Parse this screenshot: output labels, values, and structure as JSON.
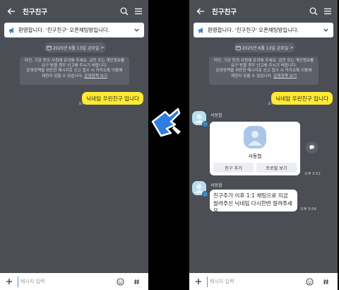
{
  "header": {
    "title": "친구친구"
  },
  "notice": {
    "text": "환영합니다. '친구친구' 오픈채팅방입니다."
  },
  "date_divider": {
    "label": "2025년 6월 13일 금요일",
    "arrow": ">"
  },
  "system_message": {
    "lines": [
      "타인, 기관 등의 사칭에 유의해 주세요. 금전 또는 개인정보를",
      "요구 받을 경우 신고해 주시기 바랍니다.",
      "운영정책을 위반한 메시지로 신고 접수 시 카카오톡 이용에",
      "제한이 있을 수 있습니다."
    ],
    "link": "운영정책 보기"
  },
  "my_message": {
    "text": "닉네임 우린친구 입니다",
    "unread": "1",
    "time": "오후 5:49"
  },
  "profile_share": {
    "sender": "서동협",
    "name": "서동협",
    "add_friend": "친구 추가",
    "view_profile": "프로필 보기",
    "time": "오후 9:52"
  },
  "reply": {
    "sender": "서동협",
    "lines": [
      "친구추가 이후 1:1 채팅으로 지금",
      "알려주신 닉네임 다시한번 알려주세요"
    ],
    "time": "오후 9:54"
  },
  "input": {
    "placeholder": "메시지 입력"
  },
  "colors": {
    "chat_bg": "#4c4e56",
    "my_bubble": "#ffeb33",
    "badge": "#2f8bd6"
  },
  "icons": [
    "back-arrow-icon",
    "search-icon",
    "menu-icon",
    "megaphone-icon",
    "chevron-down-icon",
    "calendar-icon",
    "person-icon",
    "share-icon",
    "plus-icon",
    "emoji-icon",
    "hash-icon",
    "pointing-cursor-icon"
  ]
}
